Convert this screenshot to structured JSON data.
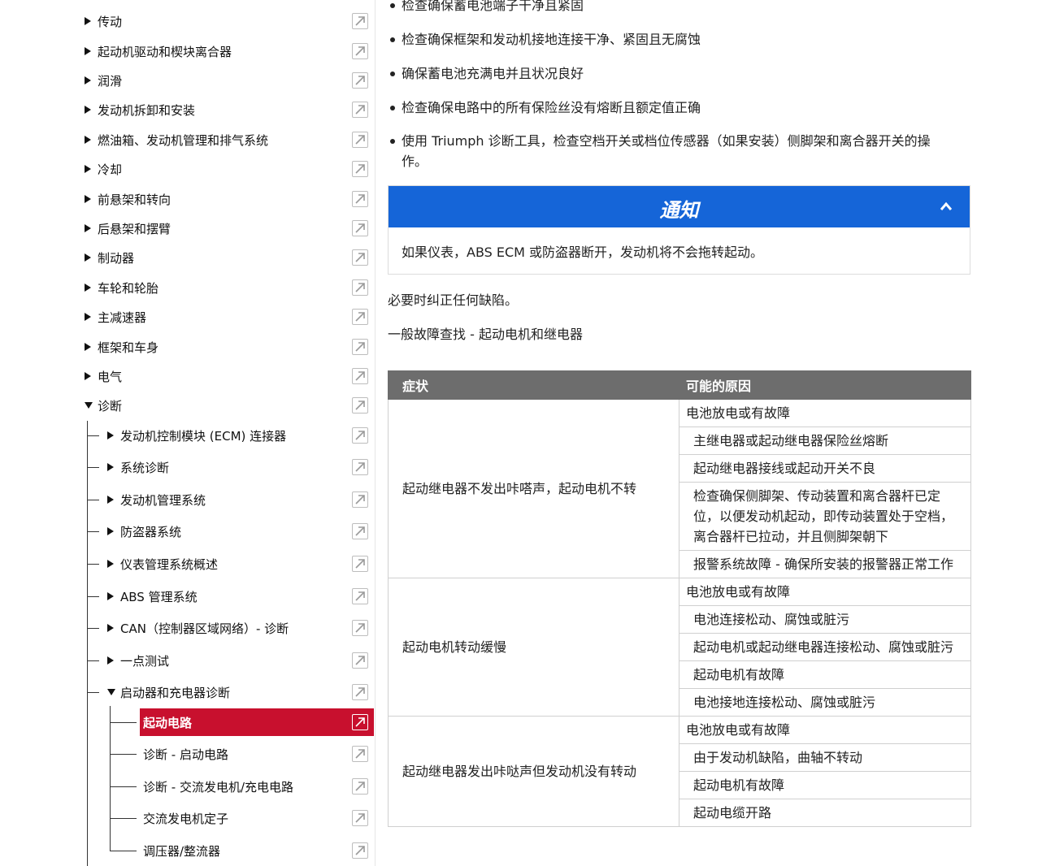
{
  "sidebar": {
    "items": [
      {
        "label": "传动",
        "expanded": false
      },
      {
        "label": "起动机驱动和楔块离合器",
        "expanded": false
      },
      {
        "label": "润滑",
        "expanded": false
      },
      {
        "label": "发动机拆卸和安装",
        "expanded": false
      },
      {
        "label": "燃油箱、发动机管理和排气系统",
        "expanded": false
      },
      {
        "label": "冷却",
        "expanded": false
      },
      {
        "label": "前悬架和转向",
        "expanded": false
      },
      {
        "label": "后悬架和摆臂",
        "expanded": false
      },
      {
        "label": "制动器",
        "expanded": false
      },
      {
        "label": "车轮和轮胎",
        "expanded": false
      },
      {
        "label": "主减速器",
        "expanded": false
      },
      {
        "label": "框架和车身",
        "expanded": false
      },
      {
        "label": "电气",
        "expanded": false
      },
      {
        "label": "诊断",
        "expanded": true
      }
    ],
    "diagnosis_children": [
      {
        "label": "发动机控制模块 (ECM) 连接器",
        "expanded": false
      },
      {
        "label": "系统诊断",
        "expanded": false
      },
      {
        "label": "发动机管理系统",
        "expanded": false
      },
      {
        "label": "防盗器系统",
        "expanded": false
      },
      {
        "label": "仪表管理系统概述",
        "expanded": false
      },
      {
        "label": "ABS 管理系统",
        "expanded": false
      },
      {
        "label": "CAN（控制器区域网络）- 诊断",
        "expanded": false
      },
      {
        "label": "一点测试",
        "expanded": false
      },
      {
        "label": "启动器和充电器诊断",
        "expanded": true
      }
    ],
    "starter_children": [
      {
        "label": "起动电路",
        "active": true
      },
      {
        "label": "诊断 - 启动电路",
        "active": false
      },
      {
        "label": "诊断 - 交流发电机/充电电路",
        "active": false
      },
      {
        "label": "交流发电机定子",
        "active": false
      },
      {
        "label": "调压器/整流器",
        "active": false
      }
    ]
  },
  "main": {
    "bullets": [
      "检查确保蓄电池端子干净且紧固",
      "检查确保框架和发动机接地连接干净、紧固且无腐蚀",
      "确保蓄电池充满电并且状况良好",
      "检查确保电路中的所有保险丝没有熔断且额定值正确",
      "使用 Triumph 诊断工具，检查空档开关或档位传感器（如果安装）侧脚架和离合器开关的操作。"
    ],
    "notice": {
      "title": "通知",
      "body": "如果仪表，ABS ECM 或防盗器断开，发动机将不会拖转起动。"
    },
    "para1": "必要时纠正任何缺陷。",
    "para2": "一般故障查找 - 起动电机和继电器",
    "table": {
      "headers": [
        "症状",
        "可能的原因"
      ],
      "groups": [
        {
          "symptom": "起动继电器不发出咔嗒声，起动电机不转",
          "causes": [
            "电池放电或有故障",
            "主继电器或起动继电器保险丝熔断",
            "起动继电器接线或起动开关不良",
            "检查确保侧脚架、传动装置和离合器杆已定位，以便发动机起动，即传动装置处于空档，离合器杆已拉动，并且侧脚架朝下",
            "报警系统故障 - 确保所安装的报警器正常工作"
          ]
        },
        {
          "symptom": "起动电机转动缓慢",
          "causes": [
            "电池放电或有故障",
            "电池连接松动、腐蚀或脏污",
            "起动电机或起动继电器连接松动、腐蚀或脏污",
            "起动电机有故障",
            "电池接地连接松动、腐蚀或脏污"
          ]
        },
        {
          "symptom": "起动继电器发出咔哒声但发动机没有转动",
          "causes": [
            "电池放电或有故障",
            "由于发动机缺陷，曲轴不转动",
            "起动电机有故障",
            "起动电缆开路"
          ]
        }
      ]
    }
  },
  "colors": {
    "active": "#c8102e",
    "notice_header": "#1565d8",
    "table_header": "#6d6d6d"
  }
}
